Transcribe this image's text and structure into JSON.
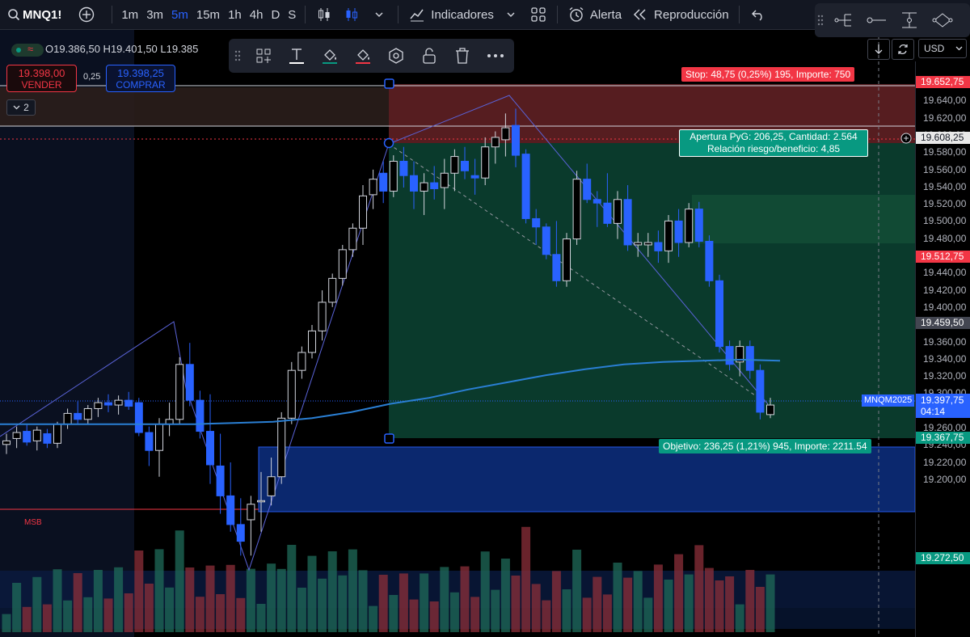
{
  "toolbar": {
    "symbol": "MNQ1!",
    "timeframes": [
      "1m",
      "3m",
      "5m",
      "15m",
      "1h",
      "4h",
      "D",
      "S"
    ],
    "active_timeframe": "5m",
    "indicators_label": "Indicadores",
    "alert_label": "Alerta",
    "replay_label": "Reproducción"
  },
  "legend": {
    "ohlc_text": "O19.386,50  H19.401,50  L19.385",
    "collapse_count": "2"
  },
  "trade_panel": {
    "sell_price": "19.398,00",
    "sell_label": "VENDER",
    "spread": "0,25",
    "buy_price": "19.398,25",
    "buy_label": "COMPRAR"
  },
  "price_scale": {
    "currency": "USD",
    "ticks": [
      "19.660,00",
      "19.640,00",
      "19.620,00",
      "19.600,00",
      "19.580,00",
      "19.560,00",
      "19.540,00",
      "19.520,00",
      "19.500,00",
      "19.480,00",
      "19.460,00",
      "19.440,00",
      "19.420,00",
      "19.400,00",
      "19.380,00",
      "19.360,00",
      "19.340,00",
      "19.320,00",
      "19.300,00",
      "19.280,00",
      "19.260,00",
      "19.240,00",
      "19.220,00",
      "19.200,00"
    ],
    "labels": {
      "stop_level": "19.652,75",
      "entry_level": "19.608,25",
      "mid_red": "19.512,75",
      "grey_level": "19.459,50",
      "last_price": "19.397,75",
      "countdown": "04:14",
      "target_level": "19.367,75",
      "bottom_green": "19.272,50"
    },
    "symbol_tag": "MNQM2025"
  },
  "position": {
    "stop_text": "Stop: 48,75 (0,25%) 195, Importe: 750",
    "open_line1": "Apertura PyG: 206,25, Cantidad: 2.564",
    "open_line2": "Relación riesgo/beneficio: 4,85",
    "target_text": "Objetivo: 236,25 (1,21%) 945, Importe: 2211.54"
  },
  "annotations": {
    "msb": "MSB"
  },
  "colors": {
    "bg": "#000000",
    "up": "#b2b5be",
    "down": "#2962ff",
    "sell": "#f23645",
    "buy": "#2962ff",
    "profit_zone": "#0b3d2e",
    "loss_zone": "#5b1f22",
    "ma": "#2a7fd4"
  },
  "chart_data": {
    "type": "candlestick",
    "symbol": "MNQ1!",
    "timeframe": "5m",
    "ylim": [
      19210,
      19670
    ],
    "candles": [
      [
        19363,
        19372,
        19355,
        19366
      ],
      [
        19368,
        19378,
        19360,
        19373
      ],
      [
        19374,
        19380,
        19362,
        19365
      ],
      [
        19366,
        19378,
        19358,
        19375
      ],
      [
        19372,
        19376,
        19360,
        19364
      ],
      [
        19364,
        19382,
        19360,
        19380
      ],
      [
        19380,
        19393,
        19376,
        19389
      ],
      [
        19389,
        19399,
        19380,
        19384
      ],
      [
        19384,
        19396,
        19380,
        19393
      ],
      [
        19393,
        19402,
        19386,
        19398
      ],
      [
        19398,
        19405,
        19390,
        19396
      ],
      [
        19396,
        19404,
        19388,
        19400
      ],
      [
        19400,
        19407,
        19392,
        19395
      ],
      [
        19398,
        19402,
        19370,
        19373
      ],
      [
        19373,
        19378,
        19345,
        19358
      ],
      [
        19358,
        19385,
        19336,
        19380
      ],
      [
        19380,
        19398,
        19370,
        19384
      ],
      [
        19384,
        19436,
        19380,
        19430
      ],
      [
        19430,
        19448,
        19395,
        19400
      ],
      [
        19400,
        19408,
        19368,
        19374
      ],
      [
        19374,
        19405,
        19330,
        19346
      ],
      [
        19345,
        19372,
        19305,
        19320
      ],
      [
        19320,
        19348,
        19290,
        19296
      ],
      [
        19296,
        19318,
        19270,
        19282
      ],
      [
        19300,
        19320,
        19270,
        19313
      ],
      [
        19316,
        19340,
        19290,
        19316
      ],
      [
        19320,
        19352,
        19312,
        19336
      ],
      [
        19336,
        19390,
        19330,
        19385
      ],
      [
        19385,
        19432,
        19380,
        19425
      ],
      [
        19425,
        19445,
        19418,
        19440
      ],
      [
        19440,
        19463,
        19435,
        19458
      ],
      [
        19458,
        19492,
        19450,
        19482
      ],
      [
        19482,
        19506,
        19478,
        19502
      ],
      [
        19502,
        19530,
        19496,
        19526
      ],
      [
        19526,
        19548,
        19520,
        19544
      ],
      [
        19544,
        19580,
        19530,
        19571
      ],
      [
        19572,
        19593,
        19560,
        19585
      ],
      [
        19590,
        19600,
        19565,
        19575
      ],
      [
        19575,
        19605,
        19570,
        19600
      ],
      [
        19600,
        19612,
        19578,
        19588
      ],
      [
        19588,
        19600,
        19560,
        19575
      ],
      [
        19575,
        19590,
        19555,
        19582
      ],
      [
        19582,
        19596,
        19568,
        19577
      ],
      [
        19578,
        19602,
        19560,
        19590
      ],
      [
        19590,
        19610,
        19575,
        19604
      ],
      [
        19600,
        19612,
        19585,
        19592
      ],
      [
        19588,
        19602,
        19572,
        19586
      ],
      [
        19586,
        19620,
        19580,
        19612
      ],
      [
        19612,
        19625,
        19598,
        19620
      ],
      [
        19618,
        19640,
        19604,
        19628
      ],
      [
        19630,
        19644,
        19595,
        19605
      ],
      [
        19606,
        19610,
        19548,
        19552
      ],
      [
        19552,
        19560,
        19530,
        19545
      ],
      [
        19545,
        19548,
        19518,
        19522
      ],
      [
        19522,
        19550,
        19495,
        19500
      ],
      [
        19500,
        19540,
        19495,
        19535
      ],
      [
        19535,
        19592,
        19530,
        19585
      ],
      [
        19585,
        19598,
        19565,
        19568
      ],
      [
        19568,
        19575,
        19545,
        19565
      ],
      [
        19565,
        19590,
        19545,
        19548
      ],
      [
        19548,
        19575,
        19535,
        19568
      ],
      [
        19568,
        19580,
        19525,
        19530
      ],
      [
        19530,
        19540,
        19520,
        19532
      ],
      [
        19530,
        19540,
        19520,
        19532
      ],
      [
        19532,
        19542,
        19515,
        19525
      ],
      [
        19525,
        19555,
        19515,
        19550
      ],
      [
        19550,
        19560,
        19520,
        19532
      ],
      [
        19532,
        19565,
        19528,
        19560
      ],
      [
        19560,
        19566,
        19528,
        19533
      ],
      [
        19533,
        19538,
        19495,
        19500
      ],
      [
        19500,
        19505,
        19440,
        19445
      ],
      [
        19445,
        19450,
        19425,
        19430
      ],
      [
        19432,
        19450,
        19420,
        19445
      ],
      [
        19445,
        19450,
        19418,
        19425
      ],
      [
        19425,
        19430,
        19384,
        19390
      ],
      [
        19388,
        19402,
        19385,
        19396
      ]
    ],
    "moving_average": [
      19380,
      19380,
      19380,
      19380,
      19380,
      19380,
      19381,
      19382,
      19385,
      19390,
      19397,
      19402,
      19409,
      19415,
      19421,
      19426,
      19430,
      19432,
      19433,
      19434,
      19433
    ]
  }
}
